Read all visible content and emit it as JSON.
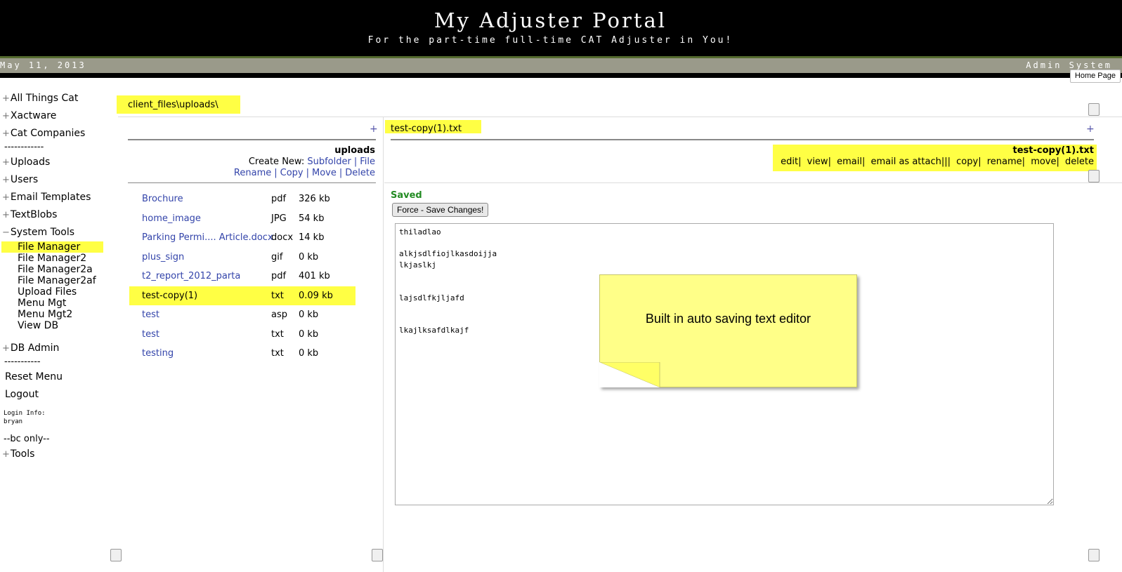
{
  "header": {
    "title": "My Adjuster Portal",
    "tagline": "For the part-time full-time CAT Adjuster in You!",
    "date": "May 11, 2013",
    "system_label": "Admin System",
    "home_button": "Home Page"
  },
  "menu": {
    "top_items": [
      {
        "label": "All Things Cat",
        "prefix": "+"
      },
      {
        "label": "Xactware",
        "prefix": "+"
      },
      {
        "label": "Cat Companies",
        "prefix": "+"
      }
    ],
    "separator": "------------",
    "mid_items": [
      {
        "label": "Uploads",
        "prefix": "+"
      },
      {
        "label": "Users",
        "prefix": "+"
      },
      {
        "label": "Email Templates",
        "prefix": "+"
      },
      {
        "label": "TextBlobs",
        "prefix": "+"
      },
      {
        "label": "System Tools",
        "prefix": "−"
      }
    ],
    "system_tools": [
      "File Manager",
      "File Manager2",
      "File Manager2a",
      "File Manager2af",
      "Upload Files",
      "Menu Mgt",
      "Menu Mgt2",
      "View DB"
    ],
    "db_admin": {
      "label": "DB Admin",
      "prefix": "+"
    },
    "separator2": "-----------",
    "reset": "Reset Menu",
    "logout": "Logout",
    "login_label": "Login Info:",
    "login_user": "bryan",
    "bc_only": "--bc only--",
    "tools": {
      "label": "Tools",
      "prefix": "+"
    }
  },
  "path": "client_files\\uploads\\",
  "file_panel": {
    "plus": "+",
    "folder": "uploads",
    "create_new_label": "Create New:",
    "subfolder": "Subfolder",
    "file": "File",
    "rename": "Rename",
    "copy": "Copy",
    "move": "Move",
    "delete": "Delete",
    "files": [
      {
        "name": "Brochure",
        "ext": "pdf",
        "size": "326 kb"
      },
      {
        "name": "home_image",
        "ext": "JPG",
        "size": "54 kb"
      },
      {
        "name": "Parking Permi.... Article.docx",
        "ext": "docx",
        "size": "14 kb"
      },
      {
        "name": "plus_sign",
        "ext": "gif",
        "size": "0 kb"
      },
      {
        "name": "t2_report_2012_parta",
        "ext": "pdf",
        "size": "401 kb"
      },
      {
        "name": "test-copy(1)",
        "ext": "txt",
        "size": "0.09 kb"
      },
      {
        "name": "test",
        "ext": "asp",
        "size": "0 kb"
      },
      {
        "name": "test",
        "ext": "txt",
        "size": "0 kb"
      },
      {
        "name": "testing",
        "ext": "txt",
        "size": "0 kb"
      }
    ]
  },
  "editor_panel": {
    "file_title": "test-copy(1).txt",
    "plus": "+",
    "action_title": "test-copy(1).txt",
    "actions": {
      "edit": "edit",
      "view": "view",
      "email": "email",
      "email_attach": "email as attach",
      "copy": "copy",
      "rename": "rename",
      "move": "move",
      "delete": "delete"
    },
    "saved": "Saved",
    "force_save": "Force - Save Changes!",
    "content": "thiladlao\n\nalkjsdlfiojlkasdoijja\nlkjaslkj\n\n\nlajsdlfkjljafd\n\n\nlkajlksafdlkajf"
  },
  "annotation": {
    "text": "Built in auto saving text editor"
  },
  "colors": {
    "highlight": "#ffff44",
    "link": "#3344aa",
    "saved": "#228b22",
    "sticky": "#ffff88"
  }
}
